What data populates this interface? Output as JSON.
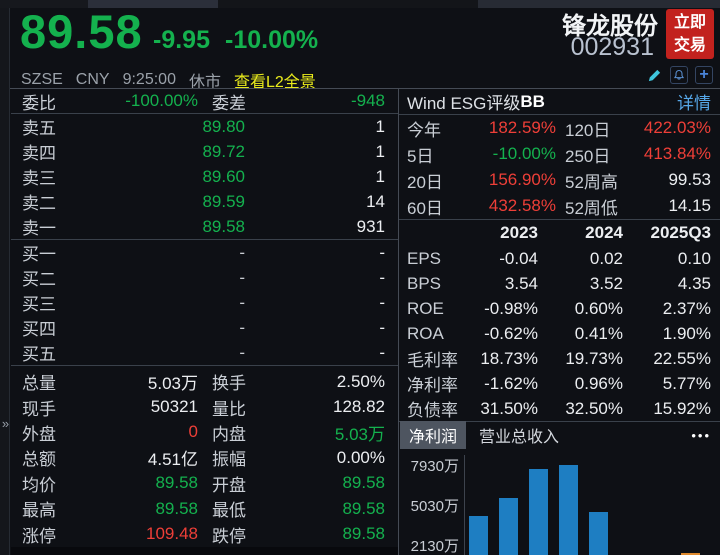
{
  "header": {
    "price": "89.58",
    "change": "-9.95",
    "change_pct": "-10.00%",
    "exchange": "SZSE",
    "currency": "CNY",
    "time": "9:25:00",
    "market_status": "休市",
    "l2_link": "查看L2全景",
    "stock_name": "锋龙股份",
    "stock_code": "002931",
    "trade_button": {
      "line1": "立即",
      "line2": "交易"
    },
    "expander_glyph": "»"
  },
  "order_book": {
    "ratio_label": "委比",
    "ratio_value": "-100.00%",
    "diff_label": "委差",
    "diff_value": "-948",
    "asks": [
      {
        "label": "卖五",
        "price": "89.80",
        "qty": "1"
      },
      {
        "label": "卖四",
        "price": "89.72",
        "qty": "1"
      },
      {
        "label": "卖三",
        "price": "89.60",
        "qty": "1"
      },
      {
        "label": "卖二",
        "price": "89.59",
        "qty": "14"
      },
      {
        "label": "卖一",
        "price": "89.58",
        "qty": "931"
      }
    ],
    "bids": [
      {
        "label": "买一",
        "price": "-",
        "qty": "-"
      },
      {
        "label": "买二",
        "price": "-",
        "qty": "-"
      },
      {
        "label": "买三",
        "price": "-",
        "qty": "-"
      },
      {
        "label": "买四",
        "price": "-",
        "qty": "-"
      },
      {
        "label": "买五",
        "price": "-",
        "qty": "-"
      }
    ]
  },
  "stats": [
    {
      "l1": "总量",
      "v1": "5.03万",
      "c1": "white",
      "l2": "换手",
      "v2": "2.50%",
      "c2": "white"
    },
    {
      "l1": "现手",
      "v1": "50321",
      "c1": "white",
      "l2": "量比",
      "v2": "128.82",
      "c2": "white"
    },
    {
      "l1": "外盘",
      "v1": "0",
      "c1": "red",
      "l2": "内盘",
      "v2": "5.03万",
      "c2": "green"
    },
    {
      "l1": "总额",
      "v1": "4.51亿",
      "c1": "white",
      "l2": "振幅",
      "v2": "0.00%",
      "c2": "white"
    },
    {
      "l1": "均价",
      "v1": "89.58",
      "c1": "green",
      "l2": "开盘",
      "v2": "89.58",
      "c2": "green"
    },
    {
      "l1": "最高",
      "v1": "89.58",
      "c1": "green",
      "l2": "最低",
      "v2": "89.58",
      "c2": "green"
    },
    {
      "l1": "涨停",
      "v1": "109.48",
      "c1": "red",
      "l2": "跌停",
      "v2": "89.58",
      "c2": "green"
    }
  ],
  "esg": {
    "title_prefix": "Wind ESG评级",
    "rating": "BB",
    "detail_link": "详情"
  },
  "performance": [
    {
      "l1": "今年",
      "v1": "182.59%",
      "c1": "red",
      "l2": "120日",
      "v2": "422.03%",
      "c2": "red"
    },
    {
      "l1": "5日",
      "v1": "-10.00%",
      "c1": "green",
      "l2": "250日",
      "v2": "413.84%",
      "c2": "red"
    },
    {
      "l1": "20日",
      "v1": "156.90%",
      "c1": "red",
      "l2": "52周高",
      "v2": "99.53",
      "c2": "white"
    },
    {
      "l1": "60日",
      "v1": "432.58%",
      "c1": "red",
      "l2": "52周低",
      "v2": "14.15",
      "c2": "white"
    }
  ],
  "financials": {
    "headers": [
      "2023",
      "2024",
      "2025Q3"
    ],
    "rows": [
      {
        "label": "EPS",
        "values": [
          "-0.04",
          "0.02",
          "0.10"
        ]
      },
      {
        "label": "BPS",
        "values": [
          "3.54",
          "3.52",
          "4.35"
        ]
      },
      {
        "label": "ROE",
        "values": [
          "-0.98%",
          "0.60%",
          "2.37%"
        ]
      },
      {
        "label": "ROA",
        "values": [
          "-0.62%",
          "0.41%",
          "1.90%"
        ]
      },
      {
        "label": "毛利率",
        "values": [
          "18.73%",
          "19.73%",
          "22.55%"
        ]
      },
      {
        "label": "净利率",
        "values": [
          "-1.62%",
          "0.96%",
          "5.77%"
        ]
      },
      {
        "label": "负债率",
        "values": [
          "31.50%",
          "32.50%",
          "15.92%"
        ]
      }
    ]
  },
  "chart_tabs": {
    "active": "净利润",
    "inactive": "营业总收入",
    "more": "•••"
  },
  "chart_data": {
    "type": "bar",
    "title": "净利润",
    "y_ticks": [
      "7930万",
      "5030万",
      "2130万"
    ],
    "tick_values": [
      7930,
      5030,
      2130
    ],
    "unit": "万",
    "series": [
      {
        "name": "净利润",
        "values": [
          4160,
          5460,
          7570,
          7860,
          4450
        ],
        "color": "#1e7ec2"
      }
    ],
    "partial_bar": {
      "value": 1480,
      "color": "#df8a2e"
    },
    "x_labels_visible": false,
    "grid": false,
    "legend_position": "none"
  },
  "colors": {
    "up_red": "#ee3f38",
    "down_green": "#14b14e",
    "link_yellow": "#e9eb1c",
    "link_blue": "#56a7e8",
    "bar_blue": "#1e7ec2",
    "bar_orange": "#df8a2e",
    "trade_button_red": "#c2221e"
  }
}
